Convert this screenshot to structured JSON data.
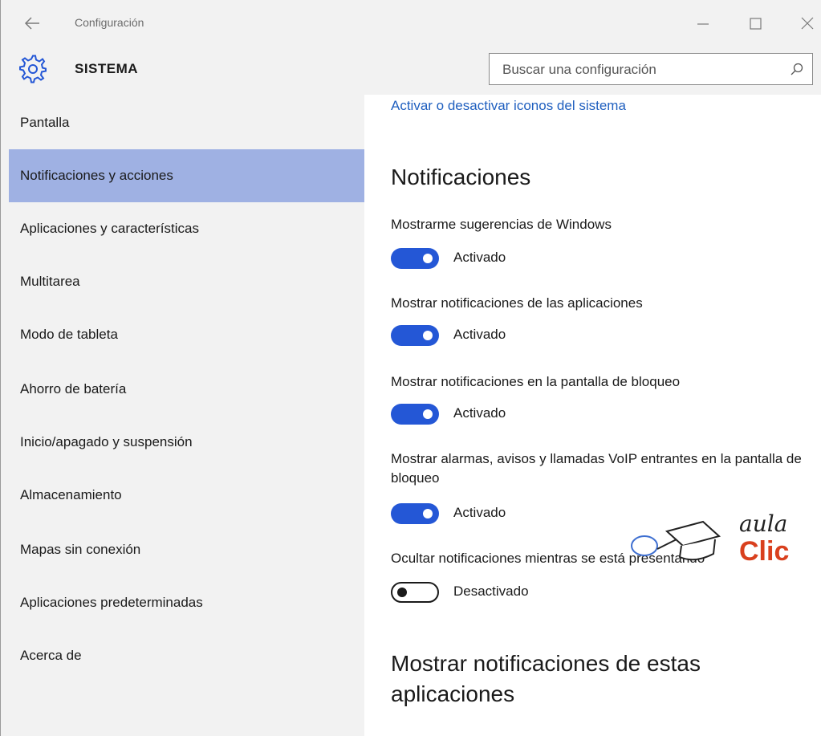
{
  "window": {
    "title": "Configuración",
    "controls": [
      "minimize",
      "maximize",
      "close"
    ]
  },
  "header": {
    "section_title": "SISTEMA",
    "search_placeholder": "Buscar una configuración"
  },
  "sidebar": {
    "items": [
      {
        "label": "Pantalla"
      },
      {
        "label": "Notificaciones y acciones",
        "selected": true
      },
      {
        "label": "Aplicaciones y características"
      },
      {
        "label": "Multitarea"
      },
      {
        "label": "Modo de tableta"
      },
      {
        "label": "Ahorro de batería"
      },
      {
        "label": "Inicio/apagado y suspensión"
      },
      {
        "label": "Almacenamiento"
      },
      {
        "label": "Mapas sin conexión"
      },
      {
        "label": "Aplicaciones predeterminadas"
      },
      {
        "label": "Acerca de"
      }
    ]
  },
  "content": {
    "link": "Activar o desactivar iconos del sistema",
    "notifications_heading": "Notificaciones",
    "settings": [
      {
        "label": "Mostrarme sugerencias de Windows",
        "state": "Activado",
        "on": true
      },
      {
        "label": "Mostrar notificaciones de las aplicaciones",
        "state": "Activado",
        "on": true
      },
      {
        "label": "Mostrar notificaciones en la pantalla de bloqueo",
        "state": "Activado",
        "on": true
      },
      {
        "label": "Mostrar alarmas, avisos y llamadas VoIP entrantes en la pantalla de bloqueo",
        "state": "Activado",
        "on": true
      },
      {
        "label": "Ocultar notificaciones mientras se está presentando",
        "state": "Desactivado",
        "on": false
      }
    ],
    "apps_heading": "Mostrar notificaciones de estas aplicaciones"
  },
  "watermark": {
    "line1": "aula",
    "line2": "Clic"
  },
  "colors": {
    "accent": "#2457d6",
    "selected_nav": "#9fb1e3",
    "link": "#1f5fbf",
    "sidebar_bg": "#f2f2f2",
    "logo_red": "#d9401e"
  }
}
